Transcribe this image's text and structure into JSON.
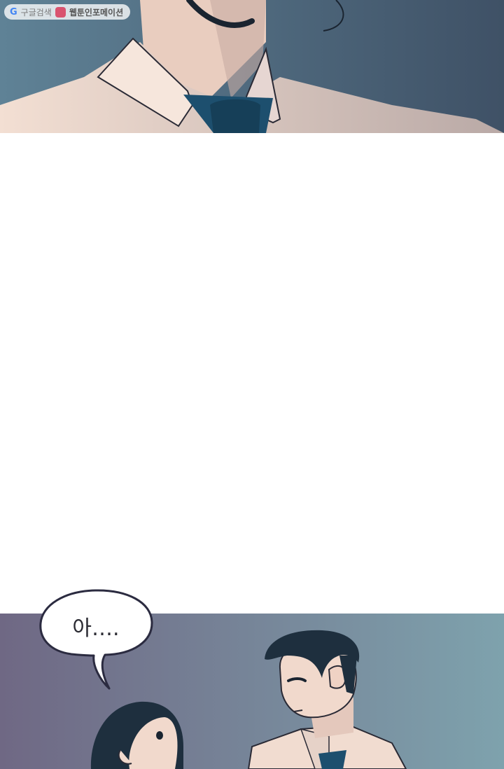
{
  "watermark": {
    "search_label": "구글검색",
    "site_label": "웹툰인포메이션",
    "google_icon": "G"
  },
  "speech": {
    "text": "아…."
  },
  "colors": {
    "top_sky_left": "#5f8296",
    "top_sky_right": "#3f5166",
    "bottom_sky_left": "#6f6884",
    "bottom_sky_right": "#7ea2ad",
    "skin": "#f1d9cc",
    "tie": "#1d4f6e",
    "hair": "#1e2f3e"
  }
}
